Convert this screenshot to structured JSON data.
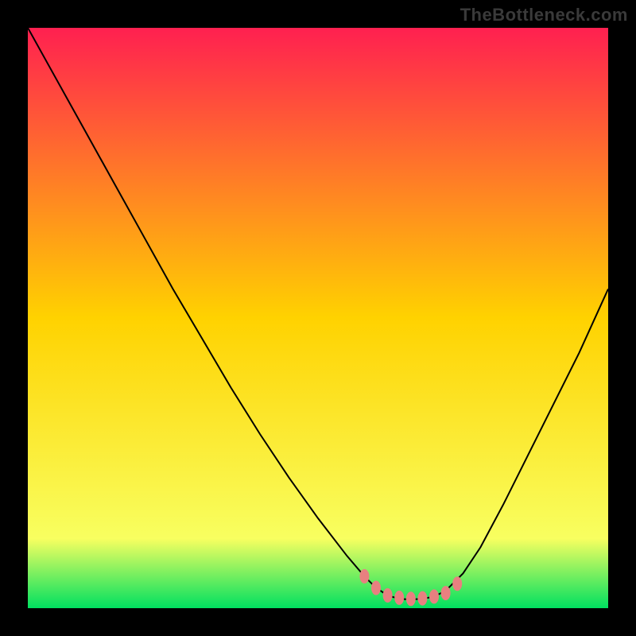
{
  "watermark": "TheBottleneck.com",
  "bg_colors": {
    "black": "#000000",
    "top": "#ff2050",
    "mid": "#ffd200",
    "low": "#f8ff60",
    "bottom": "#00e060"
  },
  "curve_color": "#000000",
  "marker_color": "#e88080",
  "chart_data": {
    "type": "line",
    "title": "",
    "xlabel": "",
    "ylabel": "",
    "xlim": [
      0,
      100
    ],
    "ylim": [
      0,
      100
    ],
    "series": [
      {
        "name": "curve",
        "x": [
          0,
          5,
          10,
          15,
          20,
          25,
          30,
          35,
          40,
          45,
          50,
          55,
          58,
          60,
          62,
          64,
          66,
          68,
          70,
          72,
          75,
          78,
          82,
          86,
          90,
          95,
          100
        ],
        "y": [
          100,
          91,
          82,
          73,
          64,
          55,
          46.5,
          38,
          30,
          22.5,
          15.5,
          9,
          5.5,
          3.5,
          2.2,
          1.6,
          1.5,
          1.6,
          2.0,
          3.0,
          6.0,
          10.5,
          18,
          26,
          34,
          44,
          55
        ]
      }
    ],
    "markers": {
      "x": [
        58,
        60,
        62,
        64,
        66,
        68,
        70,
        72,
        74
      ],
      "y": [
        5.5,
        3.5,
        2.2,
        1.8,
        1.6,
        1.7,
        2.0,
        2.6,
        4.2
      ]
    }
  }
}
